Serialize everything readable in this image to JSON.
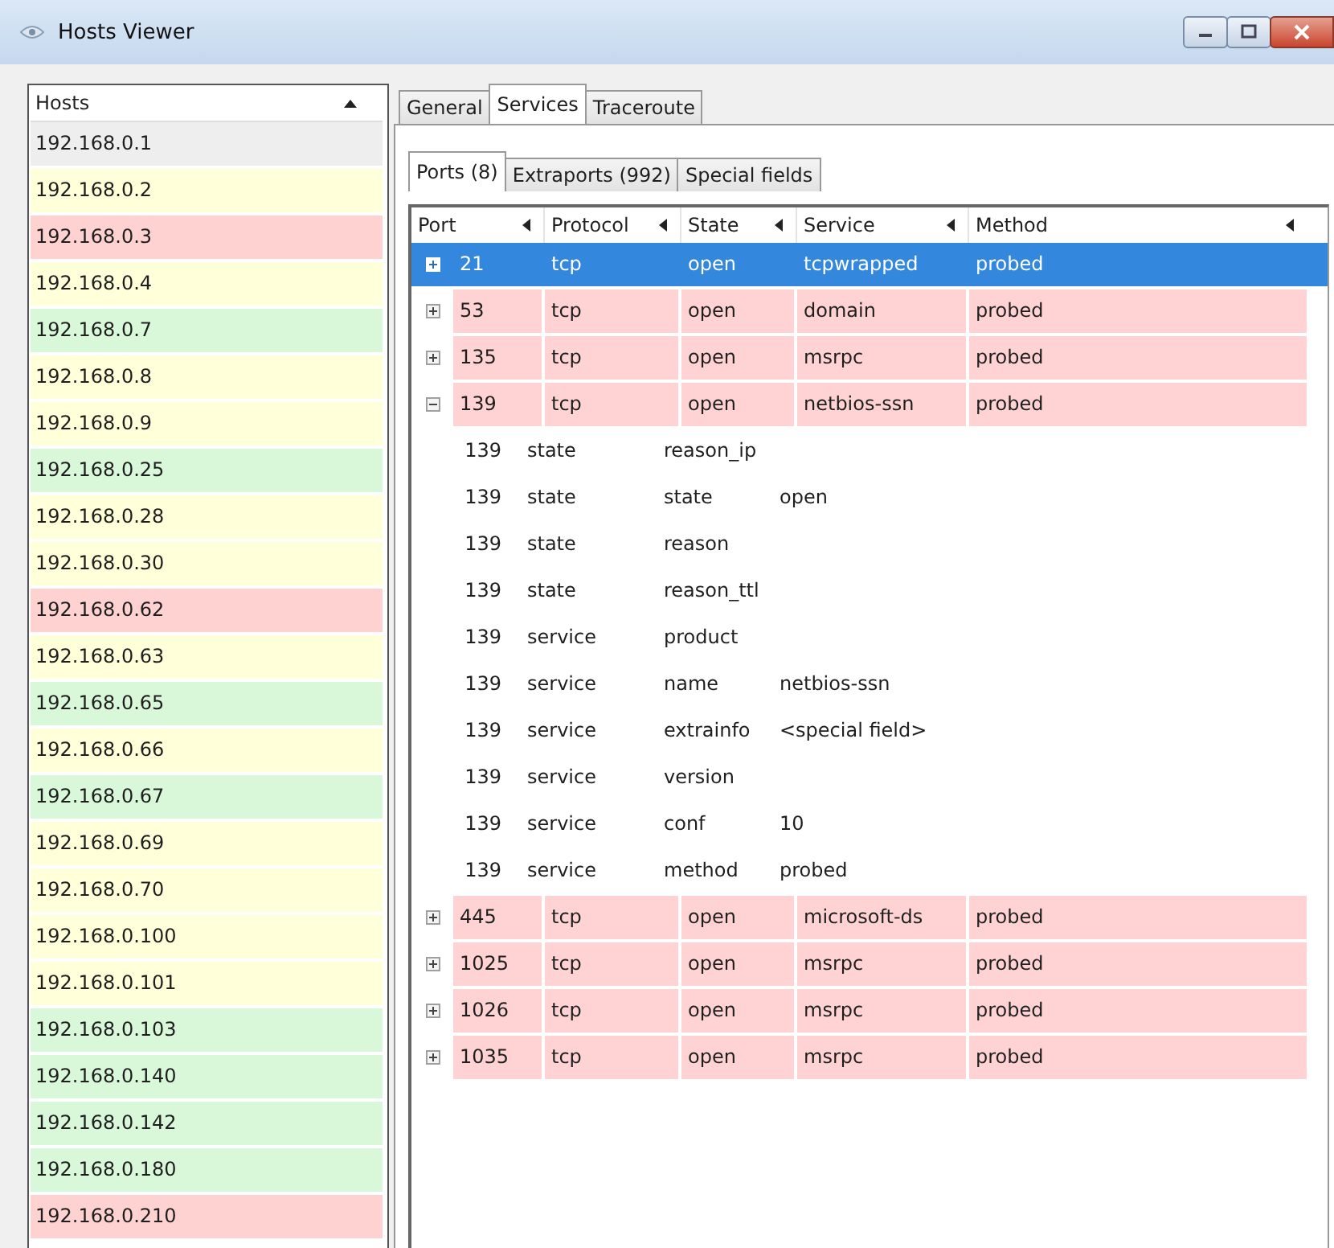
{
  "window": {
    "title": "Hosts Viewer"
  },
  "hosts": {
    "header": "Hosts",
    "items": [
      {
        "address": "192.168.0.1",
        "color": "#eeeeee"
      },
      {
        "address": "192.168.0.2",
        "color": "#ffffd9"
      },
      {
        "address": "192.168.0.3",
        "color": "#ffd2d2"
      },
      {
        "address": "192.168.0.4",
        "color": "#ffffd9"
      },
      {
        "address": "192.168.0.7",
        "color": "#d9f7d9"
      },
      {
        "address": "192.168.0.8",
        "color": "#ffffd9"
      },
      {
        "address": "192.168.0.9",
        "color": "#ffffd9"
      },
      {
        "address": "192.168.0.25",
        "color": "#d9f7d9"
      },
      {
        "address": "192.168.0.28",
        "color": "#ffffd9"
      },
      {
        "address": "192.168.0.30",
        "color": "#ffffd9"
      },
      {
        "address": "192.168.0.62",
        "color": "#ffd2d2"
      },
      {
        "address": "192.168.0.63",
        "color": "#ffffd9"
      },
      {
        "address": "192.168.0.65",
        "color": "#d9f7d9"
      },
      {
        "address": "192.168.0.66",
        "color": "#ffffd9"
      },
      {
        "address": "192.168.0.67",
        "color": "#d9f7d9"
      },
      {
        "address": "192.168.0.69",
        "color": "#ffffd9"
      },
      {
        "address": "192.168.0.70",
        "color": "#ffffd9"
      },
      {
        "address": "192.168.0.100",
        "color": "#ffffd9"
      },
      {
        "address": "192.168.0.101",
        "color": "#ffffd9"
      },
      {
        "address": "192.168.0.103",
        "color": "#d9f7d9"
      },
      {
        "address": "192.168.0.140",
        "color": "#d9f7d9"
      },
      {
        "address": "192.168.0.142",
        "color": "#d9f7d9"
      },
      {
        "address": "192.168.0.180",
        "color": "#d9f7d9"
      },
      {
        "address": "192.168.0.210",
        "color": "#ffd2d2"
      }
    ]
  },
  "tabs": [
    {
      "label": "General",
      "selected": false
    },
    {
      "label": "Services",
      "selected": true
    },
    {
      "label": "Traceroute",
      "selected": false
    }
  ],
  "subtabs": [
    {
      "label": "Ports (8)",
      "selected": true
    },
    {
      "label": "Extraports (992)",
      "selected": false
    },
    {
      "label": "Special fields",
      "selected": false
    }
  ],
  "ports": {
    "columns": [
      "Port",
      "Protocol",
      "State",
      "Service",
      "Method"
    ],
    "rows": [
      {
        "cells": [
          "21",
          "tcp",
          "open",
          "tcpwrapped",
          "probed"
        ],
        "selected": true,
        "expanded": false
      },
      {
        "cells": [
          "53",
          "tcp",
          "open",
          "domain",
          "probed"
        ],
        "selected": false,
        "expanded": false
      },
      {
        "cells": [
          "135",
          "tcp",
          "open",
          "msrpc",
          "probed"
        ],
        "selected": false,
        "expanded": false
      },
      {
        "cells": [
          "139",
          "tcp",
          "open",
          "netbios-ssn",
          "probed"
        ],
        "selected": false,
        "expanded": true,
        "children": [
          {
            "cells": [
              "139",
              "state",
              "reason_ip"
            ]
          },
          {
            "cells": [
              "139",
              "state",
              "state",
              "open"
            ]
          },
          {
            "cells": [
              "139",
              "state",
              "reason"
            ]
          },
          {
            "cells": [
              "139",
              "state",
              "reason_ttl"
            ]
          },
          {
            "cells": [
              "139",
              "service",
              "product"
            ]
          },
          {
            "cells": [
              "139",
              "service",
              "name",
              "netbios-ssn"
            ]
          },
          {
            "cells": [
              "139",
              "service",
              "extrainfo",
              "<special field>"
            ]
          },
          {
            "cells": [
              "139",
              "service",
              "version"
            ]
          },
          {
            "cells": [
              "139",
              "service",
              "conf",
              "10"
            ]
          },
          {
            "cells": [
              "139",
              "service",
              "method",
              "probed"
            ]
          }
        ]
      },
      {
        "cells": [
          "445",
          "tcp",
          "open",
          "microsoft-ds",
          "probed"
        ],
        "selected": false,
        "expanded": false
      },
      {
        "cells": [
          "1025",
          "tcp",
          "open",
          "msrpc",
          "probed"
        ],
        "selected": false,
        "expanded": false
      },
      {
        "cells": [
          "1026",
          "tcp",
          "open",
          "msrpc",
          "probed"
        ],
        "selected": false,
        "expanded": false
      },
      {
        "cells": [
          "1035",
          "tcp",
          "open",
          "msrpc",
          "probed"
        ],
        "selected": false,
        "expanded": false
      }
    ]
  }
}
